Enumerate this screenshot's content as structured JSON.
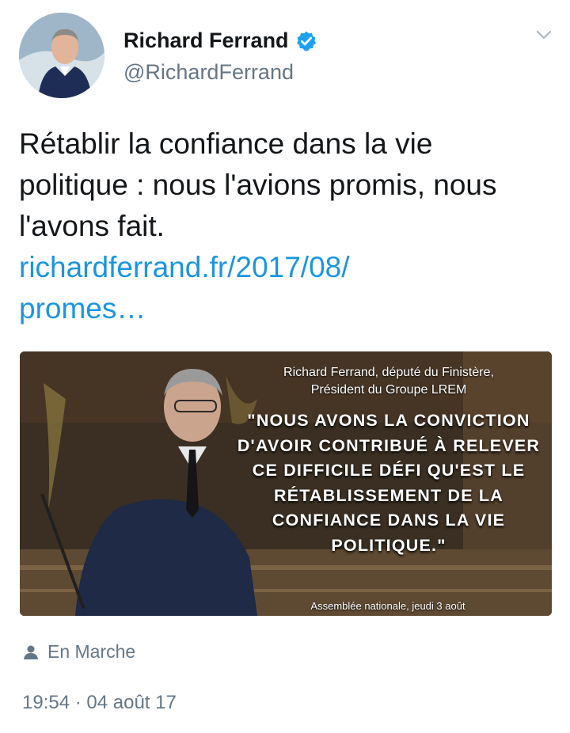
{
  "author": {
    "name": "Richard Ferrand",
    "handle": "@RichardFerrand",
    "verified": true,
    "avatar_icon": "profile-photo"
  },
  "tweet": {
    "text": "Rétablir la confiance dans la vie politique : nous l'avions promis, nous l'avons fait.",
    "link_line1": "richardferrand.fr/2017/08/",
    "link_line2": "promes…"
  },
  "media": {
    "caption_top_line1": "Richard Ferrand, député du Finistère,",
    "caption_top_line2": "Président du Groupe LREM",
    "quote": "\"NOUS AVONS LA CONVICTION D'AVOIR CONTRIBUÉ À RELEVER CE DIFFICILE DÉFI QU'EST LE RÉTABLISSEMENT DE LA CONFIANCE DANS LA VIE POLITIQUE.\"",
    "caption_bottom": "Assemblée nationale, jeudi 3 août"
  },
  "meta": {
    "location": "En Marche",
    "timestamp": "19:54 · 04 août 17"
  },
  "colors": {
    "link": "#1b95e0",
    "secondary_text": "#657786",
    "verified_badge": "#1da1f2"
  }
}
